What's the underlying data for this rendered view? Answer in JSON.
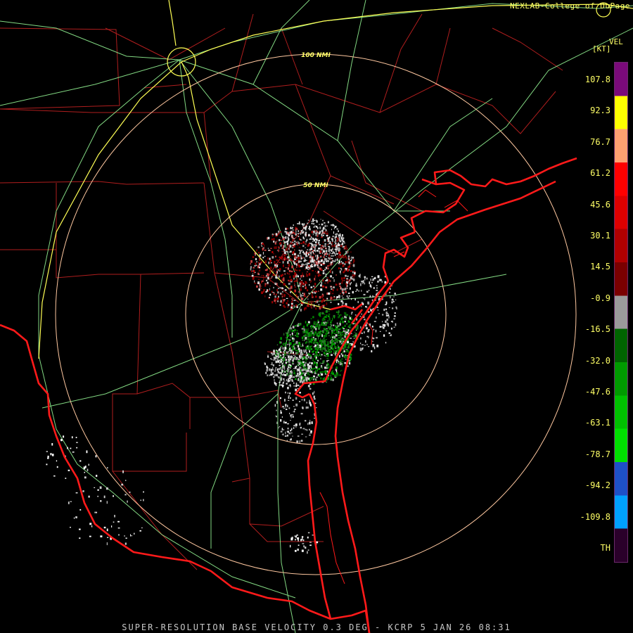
{
  "credit": "NEXLAB-College of DuPage",
  "footer": "SUPER-RESOLUTION BASE VELOCITY 0.3 DEG - KCRP 5 JAN 26 08:31",
  "rings": [
    {
      "label": "50 NMI"
    },
    {
      "label": "100 NMI"
    }
  ],
  "legend": {
    "product": "VEL",
    "unit": "[KT]",
    "labels": [
      "107.8",
      "92.3",
      "76.7",
      "61.2",
      "45.6",
      "30.1",
      "14.5",
      "-0.9",
      "-16.5",
      "-32.0",
      "-47.6",
      "-63.1",
      "-78.7",
      "-94.2",
      "-109.8",
      "TH"
    ],
    "colors": [
      "#7a0a7a",
      "#ffff00",
      "#ffa070",
      "#ff0000",
      "#dd0000",
      "#b00000",
      "#7a0000",
      "#9a9a9a",
      "#006400",
      "#009a00",
      "#00c000",
      "#00e000",
      "#1e50c8",
      "#00a0ff",
      "#2a002a"
    ]
  },
  "colors": {
    "coastline": "#ff1a1a",
    "county": "#b01e1e",
    "road": "#9aff9a",
    "interstate": "#ffff55",
    "range_ring": "#ffc8a0"
  }
}
